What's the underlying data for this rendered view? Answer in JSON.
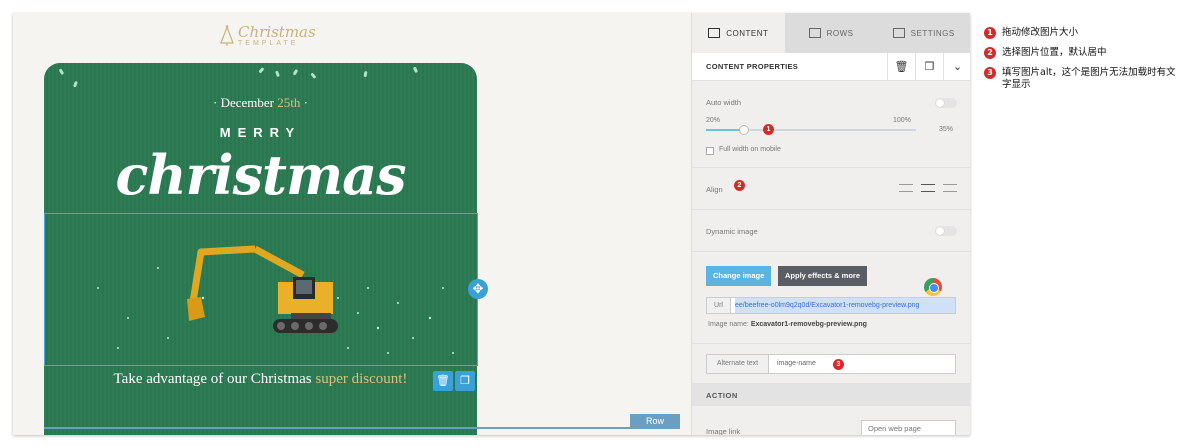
{
  "canvas": {
    "logo": {
      "title": "Christmas",
      "subtitle": "TEMPLATE"
    },
    "card": {
      "date_prefix": "· December ",
      "date_highlight": "25th",
      "date_suffix": " ·",
      "merry": "MERRY",
      "christmas": "christmas",
      "tagline_prefix": "Take advantage of our Christmas ",
      "tagline_highlight": "super discount!"
    },
    "move_icon": "✥",
    "row_actions": {
      "delete_icon": "🗑",
      "duplicate_icon": "❐"
    },
    "row_label": "Row"
  },
  "panel": {
    "tabs": [
      {
        "label": "CONTENT",
        "icon": "grid-icon",
        "active": true
      },
      {
        "label": "ROWS",
        "icon": "rows-icon",
        "active": false
      },
      {
        "label": "SETTINGS",
        "icon": "settings-icon",
        "active": false
      }
    ],
    "properties_title": "CONTENT PROPERTIES",
    "header_icons": {
      "delete": "🗑",
      "duplicate": "❐",
      "collapse": "⌄"
    },
    "auto_width": {
      "label": "Auto width",
      "enabled": false
    },
    "width_slider": {
      "min_label": "20%",
      "max_label": "100%",
      "value_label": "35%",
      "value": 35
    },
    "full_width_mobile": {
      "label": "Full width on mobile",
      "checked": false
    },
    "align": {
      "label": "Align",
      "value": "center"
    },
    "dynamic_image": {
      "label": "Dynamic image",
      "enabled": false
    },
    "change_image_label": "Change image",
    "apply_effects_label": "Apply effects & more",
    "url": {
      "label": "Url",
      "value": "ee/beefree-o0lm9q2q0d/Excavator1-removebg-preview.png"
    },
    "image_name": {
      "label": "Image name:",
      "value": "Excavator1-removebg-preview.png"
    },
    "alt_text": {
      "label": "Alternate text",
      "value": "image-name"
    },
    "action_title": "ACTION",
    "image_link": {
      "label": "Image link",
      "value": "Open web page"
    }
  },
  "annotations": {
    "badges": [
      "1",
      "2",
      "3"
    ],
    "notes": [
      {
        "num": "1",
        "text": "拖动修改图片大小"
      },
      {
        "num": "2",
        "text": "选择图片位置，默认居中"
      },
      {
        "num": "3",
        "text": "填写图片alt，这个是图片无法加载时有文字显示"
      }
    ]
  },
  "colors": {
    "card_green": "#2a7a52",
    "gold": "#d9c07c",
    "accent_blue": "#5bb4e0",
    "badge_red": "#d52a2a"
  }
}
